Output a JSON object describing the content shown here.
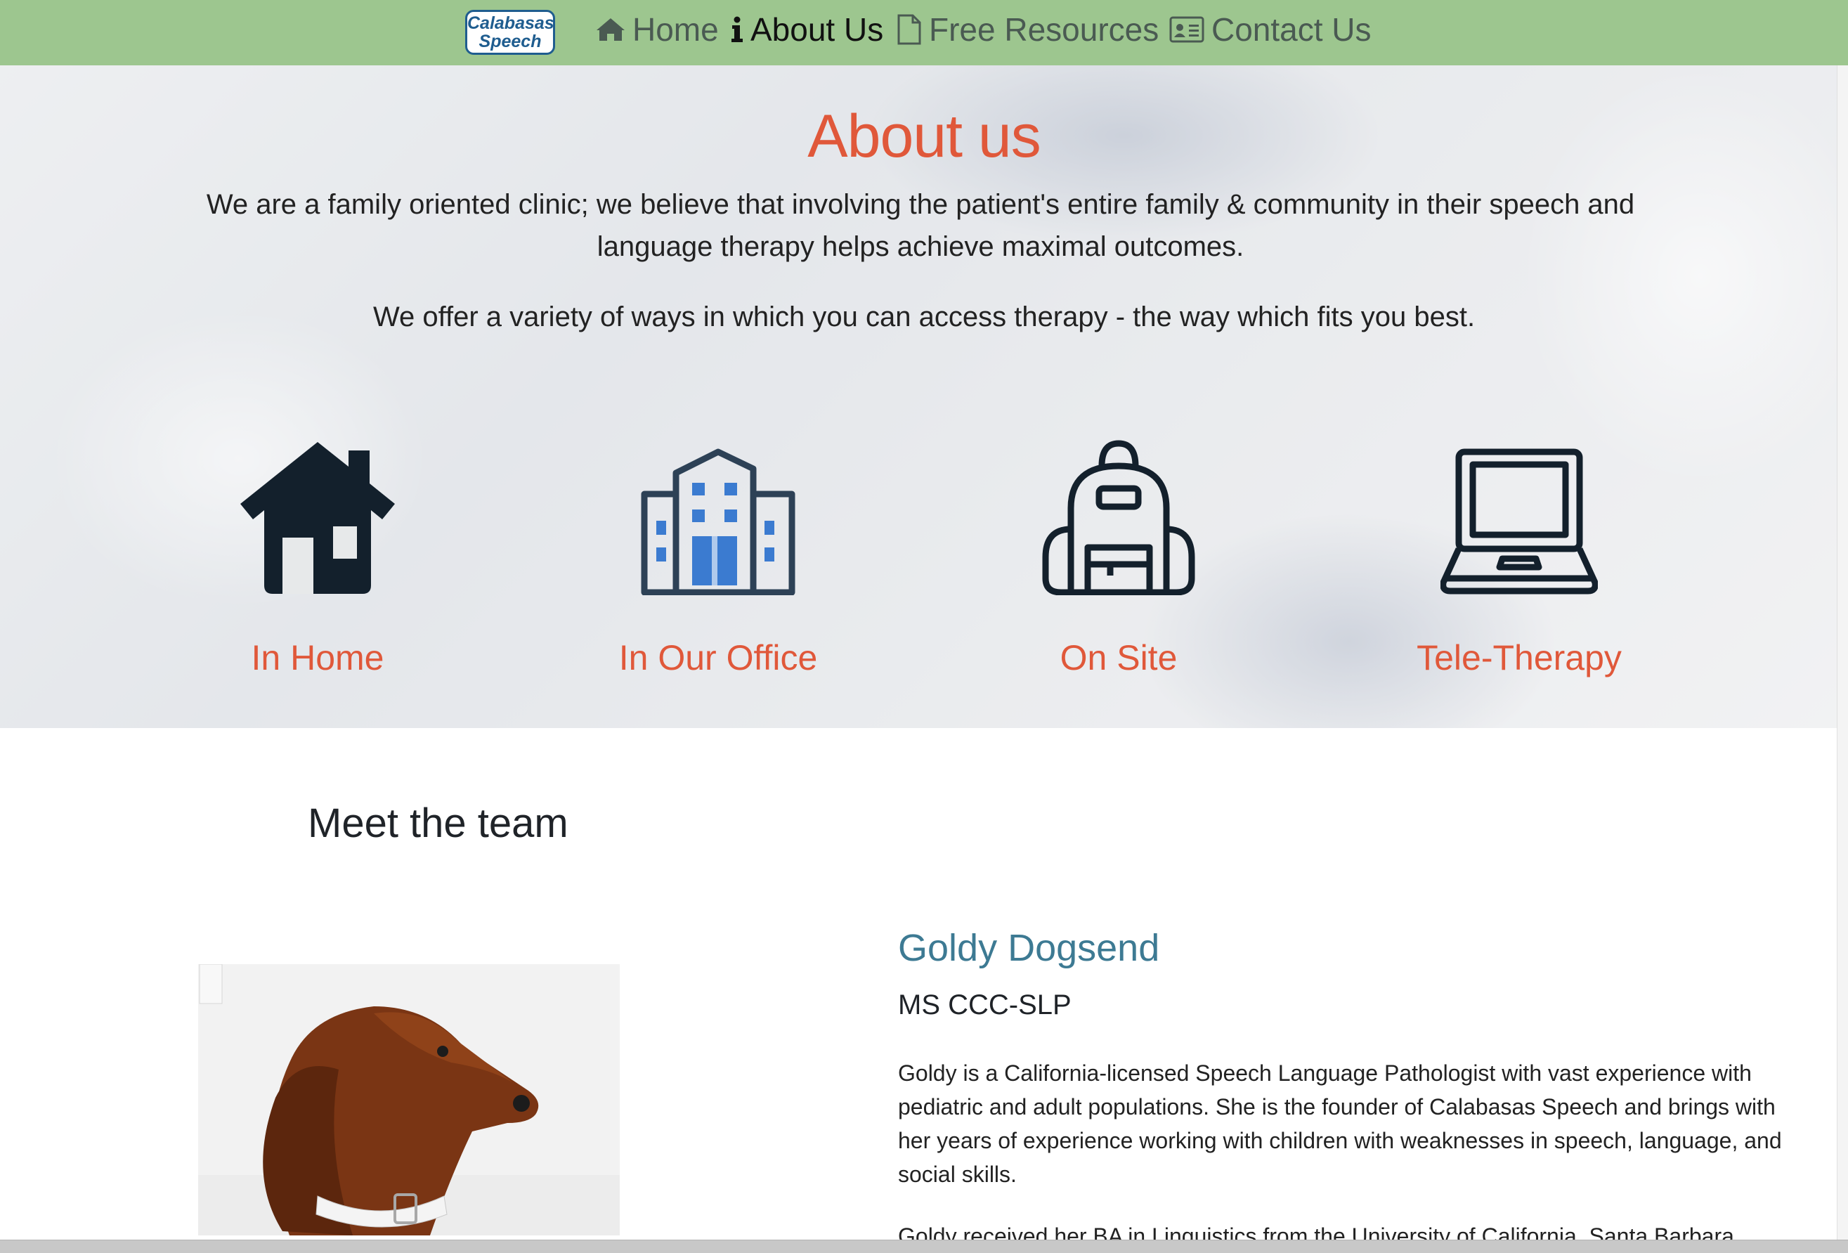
{
  "nav": {
    "logo_line1": "Calabasas",
    "logo_line2": "Speech",
    "items": [
      {
        "label": "Home",
        "icon": "home-icon",
        "active": false
      },
      {
        "label": "About Us",
        "icon": "info-icon",
        "active": true
      },
      {
        "label": "Free Resources",
        "icon": "document-icon",
        "active": false
      },
      {
        "label": "Contact Us",
        "icon": "contact-card-icon",
        "active": false
      }
    ]
  },
  "hero": {
    "title": "About us",
    "paragraph1": "We are a family oriented clinic; we believe that involving the patient's entire family & community in their speech and language therapy helps achieve maximal outcomes.",
    "paragraph2": "We offer a variety of ways in which you can access therapy - the way which fits you best.",
    "services": [
      {
        "label": "In Home",
        "icon": "house-icon"
      },
      {
        "label": "In Our Office",
        "icon": "office-building-icon"
      },
      {
        "label": "On Site",
        "icon": "backpack-icon"
      },
      {
        "label": "Tele-Therapy",
        "icon": "laptop-icon"
      }
    ],
    "colors": {
      "accent": "#e0583a",
      "nav_bg": "#9dc68f"
    }
  },
  "team": {
    "heading": "Meet the team",
    "member": {
      "name": "Goldy Dogsend",
      "credentials": "MS CCC-SLP",
      "bio": "Goldy is a California-licensed Speech Language Pathologist with vast experience with pediatric and adult populations. She is the founder of Calabasas Speech and brings with her years of experience working with children with weaknesses in speech, language, and social skills.",
      "bio_continued": "Goldy received her BA in Linguistics from the University of California, Santa Barbara"
    }
  }
}
